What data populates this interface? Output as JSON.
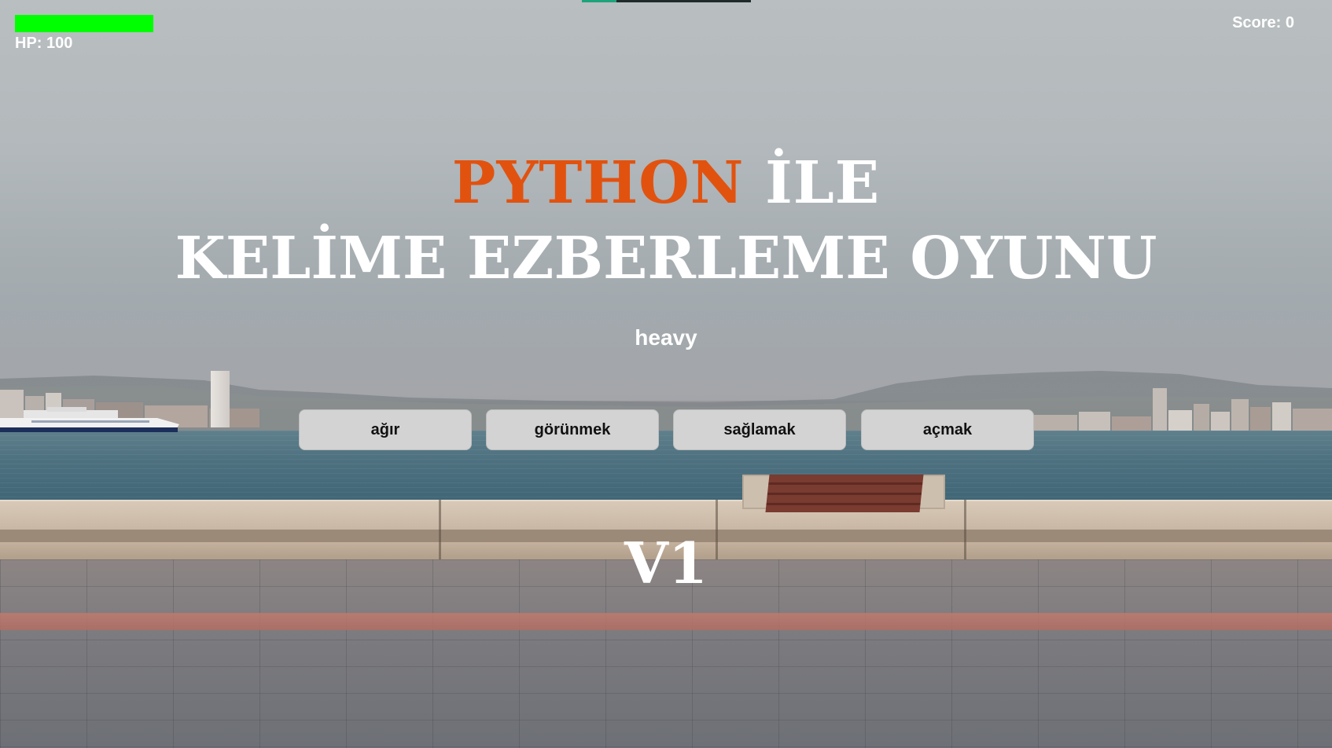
{
  "hud": {
    "hp_label": "HP: 100",
    "hp_value": 100,
    "hp_max": 100,
    "hp_color": "#00ff00",
    "score_label": "Score: 0"
  },
  "title": {
    "highlight": "PYTHON",
    "line1_rest": "İLE",
    "line2": "KELİME EZBERLEME OYUNU",
    "highlight_color": "#e2520f"
  },
  "question": {
    "word": "heavy"
  },
  "answers": [
    {
      "label": "ağır"
    },
    {
      "label": "görünmek"
    },
    {
      "label": "sağlamak"
    },
    {
      "label": "açmak"
    }
  ],
  "version": "V1"
}
